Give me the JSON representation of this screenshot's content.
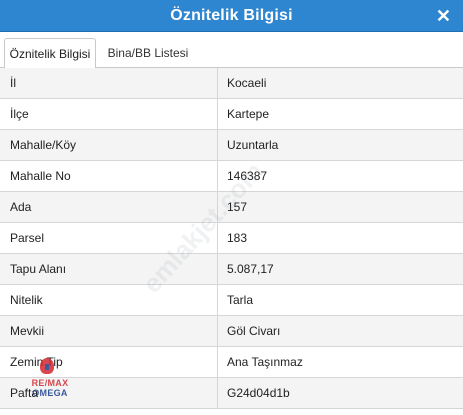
{
  "window": {
    "title": "Öznitelik Bilgisi",
    "close_icon": "close-icon"
  },
  "tabs": [
    {
      "label": "Öznitelik Bilgisi",
      "active": true
    },
    {
      "label": "Bina/BB Listesi",
      "active": false
    }
  ],
  "rows": [
    {
      "key": "İl",
      "value": "Kocaeli"
    },
    {
      "key": "İlçe",
      "value": "Kartepe"
    },
    {
      "key": "Mahalle/Köy",
      "value": "Uzuntarla"
    },
    {
      "key": "Mahalle No",
      "value": "146387"
    },
    {
      "key": "Ada",
      "value": "157"
    },
    {
      "key": "Parsel",
      "value": "183"
    },
    {
      "key": "Tapu Alanı",
      "value": "5.087,17"
    },
    {
      "key": "Nitelik",
      "value": "Tarla"
    },
    {
      "key": "Mevkii",
      "value": "Göl Civarı"
    },
    {
      "key": "Zemin Tip",
      "value": "Ana Taşınmaz"
    },
    {
      "key": "Pafta",
      "value": "G24d04d1b"
    }
  ],
  "overlay": {
    "logo_line1": "RE/MAX",
    "logo_line2": "OMEGA",
    "watermark": "emlakjet.com"
  },
  "colors": {
    "titlebar": "#2e86d0",
    "row_alt": "#f4f4f4",
    "border": "#d6d6d6"
  }
}
